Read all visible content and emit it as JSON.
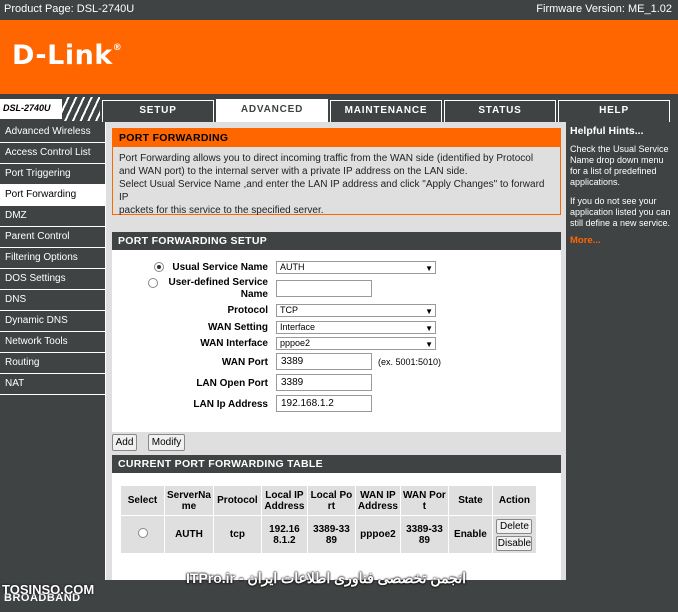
{
  "header": {
    "product": "Product Page: DSL-2740U",
    "firmware": "Firmware Version: ME_1.02",
    "logo": "D-Link",
    "logo_reg": "®",
    "model": "DSL-2740U"
  },
  "tabs": [
    {
      "label": "SETUP"
    },
    {
      "label": "ADVANCED"
    },
    {
      "label": "MAINTENANCE"
    },
    {
      "label": "STATUS"
    },
    {
      "label": "HELP"
    }
  ],
  "sidebar": {
    "items": [
      "Advanced Wireless",
      "Access Control List",
      "Port Triggering",
      "Port Forwarding",
      "DMZ",
      "Parent Control",
      "Filtering Options",
      "DOS Settings",
      "DNS",
      "Dynamic DNS",
      "Network Tools",
      "Routing",
      "NAT"
    ]
  },
  "port_forwarding": {
    "title": "PORT FORWARDING",
    "line1": "Port Forwarding allows you to direct incoming traffic from the WAN side (identified by Protocol",
    "line2": "and WAN port) to the internal server with a private IP address on the LAN side.",
    "line3": "Select Usual Service Name ,and enter the LAN IP address and click \"Apply Changes\" to forward IP",
    "line4": "packets for this service to the specified server."
  },
  "setup": {
    "title": "PORT FORWARDING SETUP",
    "usual_service_label": "Usual Service Name",
    "usual_service_value": "AUTH",
    "user_defined_label_1": "User-defined Service",
    "user_defined_label_2": "Name",
    "user_defined_value": "",
    "protocol_label": "Protocol",
    "protocol_value": "TCP",
    "wan_setting_label": "WAN Setting",
    "wan_setting_value": "Interface",
    "wan_interface_label": "WAN Interface",
    "wan_interface_value": "pppoe2",
    "wan_port_label": "WAN Port",
    "wan_port_value": "3389",
    "wan_port_hint": "(ex. 5001:5010)",
    "lan_open_port_label": "LAN Open Port",
    "lan_open_port_value": "3389",
    "lan_ip_label": "LAN Ip Address",
    "lan_ip_value": "192.168.1.2"
  },
  "buttons": {
    "add": "Add",
    "modify": "Modify"
  },
  "table": {
    "title": "CURRENT PORT FORWARDING TABLE",
    "headers": {
      "select": "Select",
      "server_1": "ServerNa",
      "server_2": "me",
      "protocol": "Protocol",
      "lanip_1": "Local IP",
      "lanip_2": "Address",
      "lport_1": "Local Po",
      "lport_2": "rt",
      "wanip_1": "WAN IP",
      "wanip_2": "Address",
      "wport_1": "WAN Por",
      "wport_2": "t",
      "state": "State",
      "action": "Action"
    },
    "row": {
      "server": "AUTH",
      "protocol": "tcp",
      "lanip_1": "192.16",
      "lanip_2": "8.1.2",
      "lport_1": "3389-33",
      "lport_2": "89",
      "wanip": "pppoe2",
      "wport_1": "3389-33",
      "wport_2": "89",
      "state": "Enable",
      "delete": "Delete",
      "disable": "Disable"
    }
  },
  "help": {
    "title": "Helpful Hints...",
    "text1": "Check the Usual Service Name drop down menu for a list of predefined applications.",
    "text2": "If you do not see your application listed you can still define a new service.",
    "more": "More..."
  },
  "footer": {
    "broadband": "BROADBAND"
  },
  "watermark": {
    "left": "TOSINSO.COM",
    "center": "انجمن تخصصی فناوری اطلاعات ایران - ITPro.ir"
  },
  "colors": {
    "orange": "#ff6600",
    "dark": "#404343",
    "panel": "#dfdfdf"
  }
}
